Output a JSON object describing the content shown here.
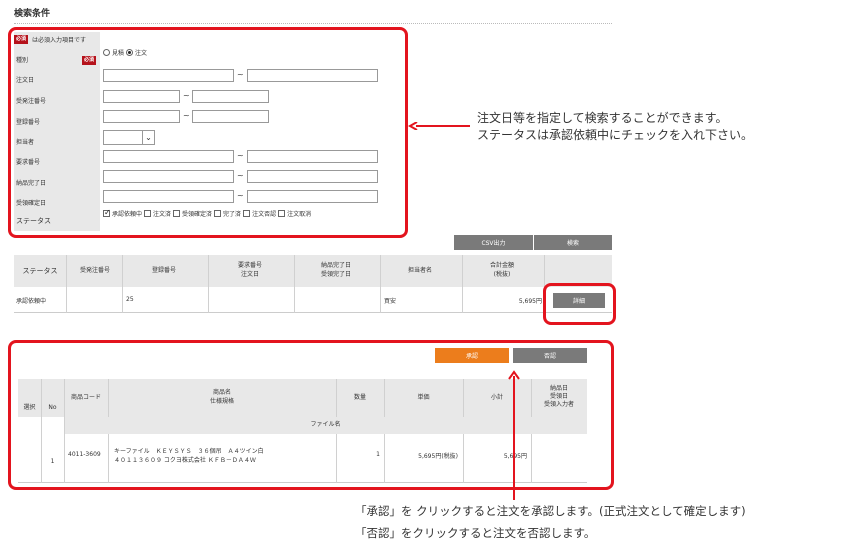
{
  "section": {
    "title": "検索条件"
  },
  "form": {
    "required_badge": "必須",
    "required_note": "は必須入力項目です",
    "type_label": "種別",
    "type_options": [
      "見積",
      "注文"
    ],
    "order_date_label": "注文日",
    "order_no_label": "受発注番号",
    "reg_no_label": "登録番号",
    "staff_label": "担当者",
    "request_no_label": "要求番号",
    "delivery_label": "納品完了日",
    "receipt_label": "受領確定日",
    "status_label": "ステータス",
    "range_sep": "~",
    "status_options": [
      "承認依頼中",
      "注文済",
      "受領確定済",
      "完了済",
      "注文否認",
      "注文取消"
    ]
  },
  "buttons": {
    "csv": "CSV出力",
    "search": "検索",
    "detail": "詳細",
    "approve": "承認",
    "reject": "否認"
  },
  "results": {
    "headers": {
      "status": "ステータス",
      "order_no": "受発注番号",
      "reg_no": "登録番号",
      "request_no": "要求番号",
      "order_date": "注文日",
      "delivery_done": "納品完了日",
      "receipt_done": "受領完了日",
      "staff_name": "担当者名",
      "total": "合計金額",
      "tax_excl": "(税抜)"
    },
    "row": {
      "status": "承認依頼中",
      "reg_no": "25",
      "staff": "買安",
      "total": "5,695円"
    }
  },
  "items": {
    "headers": {
      "select": "選択",
      "no": "No",
      "code": "商品コード",
      "name": "商品名",
      "spec": "仕様規格",
      "qty": "数量",
      "price": "単価",
      "subtotal": "小計",
      "delivery_date": "納品日",
      "receipt_date": "受領日",
      "receiver": "受領入力者",
      "file_name": "ファイル名"
    },
    "row": {
      "no": "1",
      "code": "4011-3609",
      "name": "キーファイル　ＫＥＹＳＹＳ　３６個吊　Ａ４ツイン白",
      "spec": "４０１１３６０９ コクヨ株式会社 ＫＦＢ－ＤＡ４Ｗ",
      "qty": "1",
      "price": "5,695円(税抜)",
      "subtotal": "5,695円"
    }
  },
  "annotations": {
    "right_line1": "注文日等を指定して検索することができます。",
    "right_line2": "ステータスは承認依頼中にチェックを入れ下さい。",
    "bottom_line1": "「承認」を クリックすると注文を承認します。(正式注文として確定します)",
    "bottom_line2": "「否認」をクリックすると注文を否認します。"
  },
  "colors": {
    "highlight": "#e3141e",
    "approve": "#ec7d1c",
    "button": "#7a7a7a"
  }
}
